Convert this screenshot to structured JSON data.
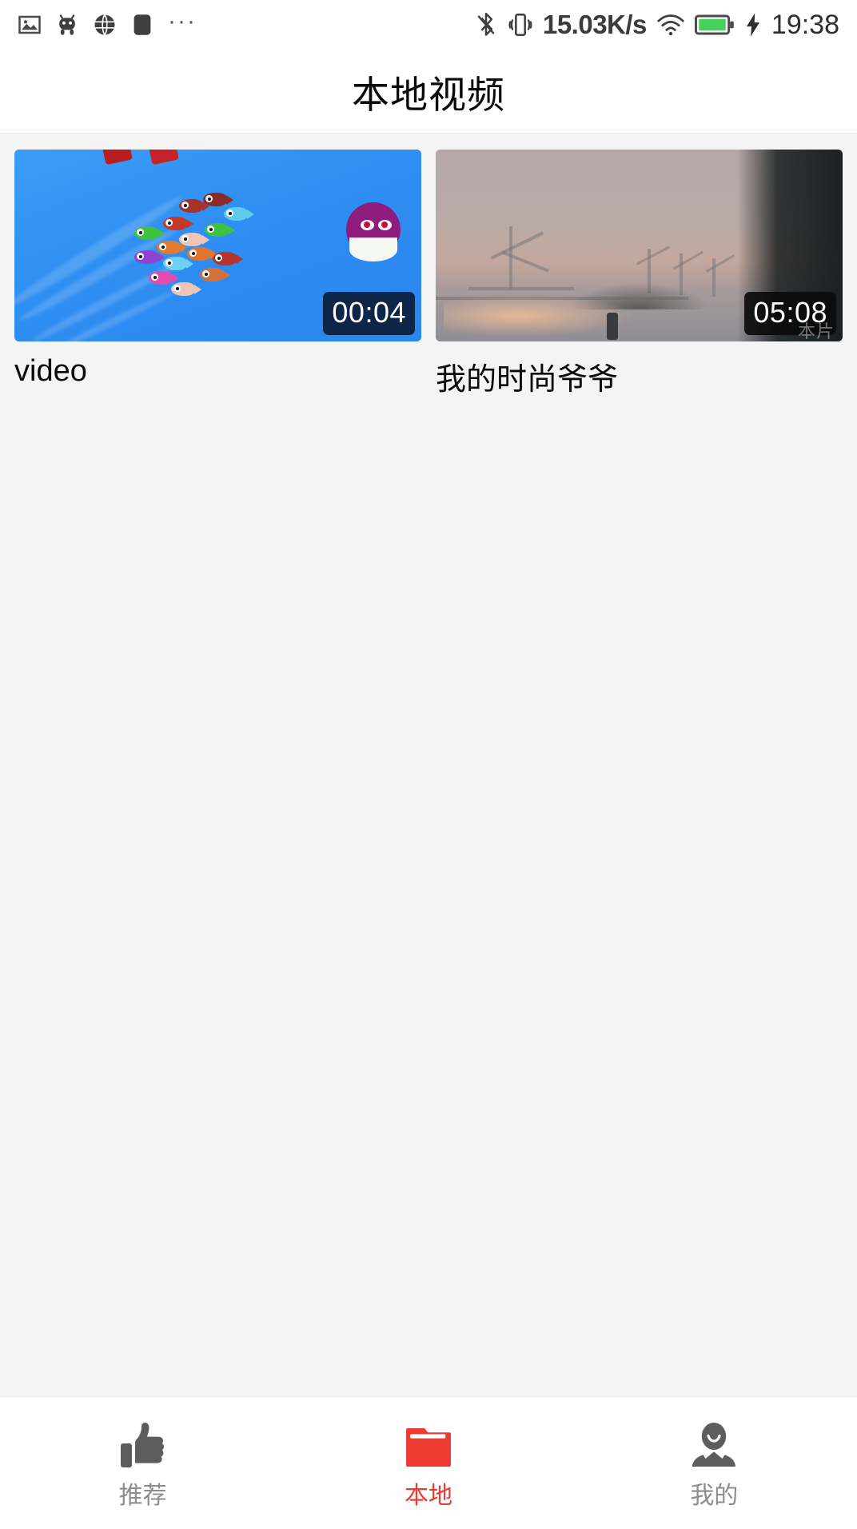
{
  "statusbar": {
    "left_icons": [
      "image-icon",
      "android-robot-icon",
      "globe-browser-icon",
      "app-square-icon"
    ],
    "overflow": "···",
    "bluetooth_icon": "bluetooth-off-icon",
    "vibrate_icon": "vibrate-mode-icon",
    "network_speed": "15.03K/s",
    "wifi_icon": "wifi-icon",
    "battery_icon": "battery-full-icon",
    "charging_icon": "charging-bolt-icon",
    "battery_color": "#45d25a",
    "clock": "19:38"
  },
  "header": {
    "title": "本地视频"
  },
  "videos": [
    {
      "title": "video",
      "duration": "00:04",
      "thumb_name": "fish-game-thumbnail",
      "watermark": ""
    },
    {
      "title": "我的时尚爷爷",
      "duration": "05:08",
      "thumb_name": "harbor-sunset-thumbnail",
      "watermark": "本片"
    }
  ],
  "bottom_nav": {
    "active_color": "#ed3b31",
    "inactive_color": "#8c8c8c",
    "items": [
      {
        "label": "推荐",
        "icon": "thumbs-up-icon",
        "active": false
      },
      {
        "label": "本地",
        "icon": "folder-icon",
        "active": true
      },
      {
        "label": "我的",
        "icon": "person-icon",
        "active": false
      }
    ]
  }
}
